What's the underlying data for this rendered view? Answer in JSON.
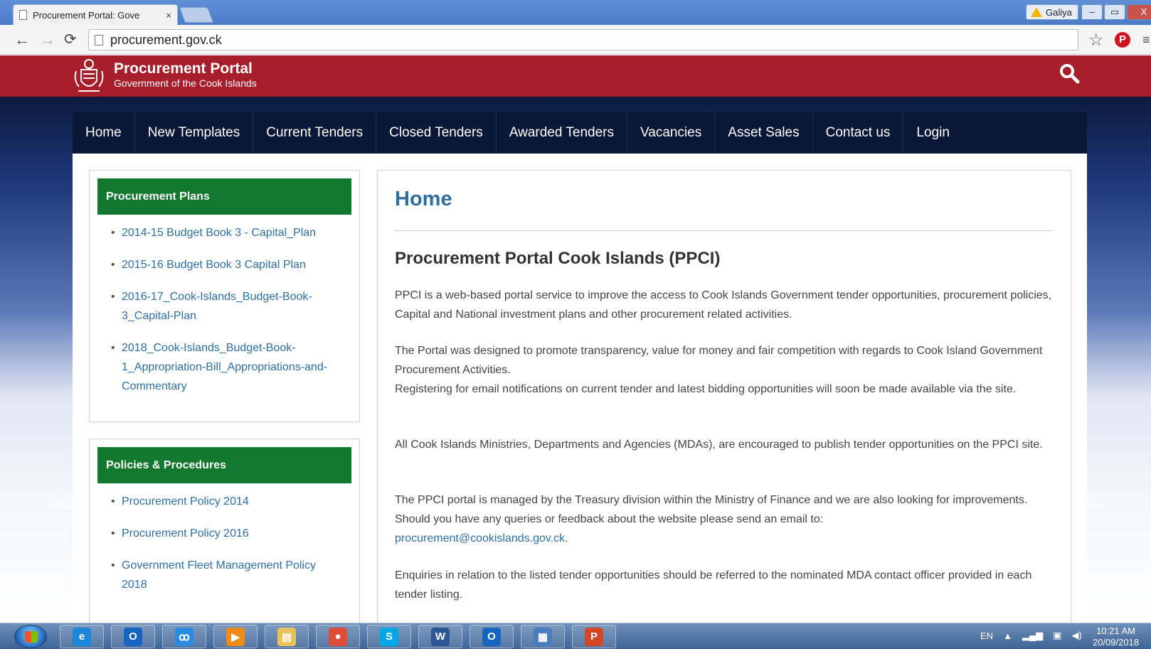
{
  "browser": {
    "tab_title": "Procurement Portal: Gove",
    "tab_close": "×",
    "url": "procurement.gov.ck",
    "user_name": "Galiya",
    "window_buttons": [
      "–",
      "▭",
      "X"
    ]
  },
  "site": {
    "title": "Procurement Portal",
    "subtitle": "Government of the Cook Islands"
  },
  "nav": [
    "Home",
    "New Templates",
    "Current Tenders",
    "Closed Tenders",
    "Awarded Tenders",
    "Vacancies",
    "Asset Sales",
    "Contact us",
    "Login"
  ],
  "sidebar": {
    "plans": {
      "heading": "Procurement Plans",
      "items": [
        "2014-15 Budget Book 3 - Capital_Plan",
        "2015-16 Budget Book 3 Capital Plan",
        "2016-17_Cook-Islands_Budget-Book-3_Capital-Plan",
        "2018_Cook-Islands_Budget-Book-1_Appropriation-Bill_Appropriations-and-Commentary"
      ]
    },
    "policies": {
      "heading": "Policies & Procedures",
      "items": [
        "Procurement Policy 2014",
        "Procurement Policy 2016",
        "Government Fleet Management Policy 2018"
      ]
    }
  },
  "main": {
    "title": "Home",
    "subtitle": "Procurement Portal Cook Islands (PPCI)",
    "p1": "PPCI is a web-based portal service to improve the access to Cook Islands Government tender opportunities, procurement policies, Capital and National investment plans and other procurement related activities.",
    "p2a": "The Portal was designed to promote transparency, value for money and fair competition with regards to Cook Island Government Procurement Activities.",
    "p2b": "Registering for email notifications on current tender and latest bidding opportunities will soon be made available via the site.",
    "p3": "All Cook Islands Ministries, Departments and Agencies (MDAs), are encouraged to publish tender opportunities on the PPCI site.",
    "p4": "The PPCI portal is managed by the Treasury division within the Ministry of Finance and we are also looking for improvements. Should you have any queries or feedback about the website please send an email to:",
    "email": "procurement@cookislands.gov.ck.",
    "p5": "Enquiries in relation to the listed tender opportunities should be referred to the nominated MDA contact officer provided in each tender listing."
  },
  "taskbar": {
    "apps": [
      {
        "name": "internet-explorer-icon",
        "glyph": "e",
        "color": "#1e88d8"
      },
      {
        "name": "outlook-icon",
        "glyph": "O",
        "color": "#1565c0"
      },
      {
        "name": "lync-icon",
        "glyph": "ꝏ",
        "color": "#2a8be0"
      },
      {
        "name": "media-player-icon",
        "glyph": "▶",
        "color": "#f08a12"
      },
      {
        "name": "file-explorer-icon",
        "glyph": "▤",
        "color": "#e8c35a"
      },
      {
        "name": "chrome-icon",
        "glyph": "●",
        "color": "#dd4b39"
      },
      {
        "name": "skype-icon",
        "glyph": "S",
        "color": "#00a8e8"
      },
      {
        "name": "word-icon",
        "glyph": "W",
        "color": "#2b5797"
      },
      {
        "name": "outlook-2-icon",
        "glyph": "O",
        "color": "#1565c0"
      },
      {
        "name": "control-panel-icon",
        "glyph": "▦",
        "color": "#4c7cc0"
      },
      {
        "name": "powerpoint-icon",
        "glyph": "P",
        "color": "#d24726"
      }
    ],
    "lang": "EN",
    "time": "10:21 AM",
    "date": "20/09/2018"
  }
}
